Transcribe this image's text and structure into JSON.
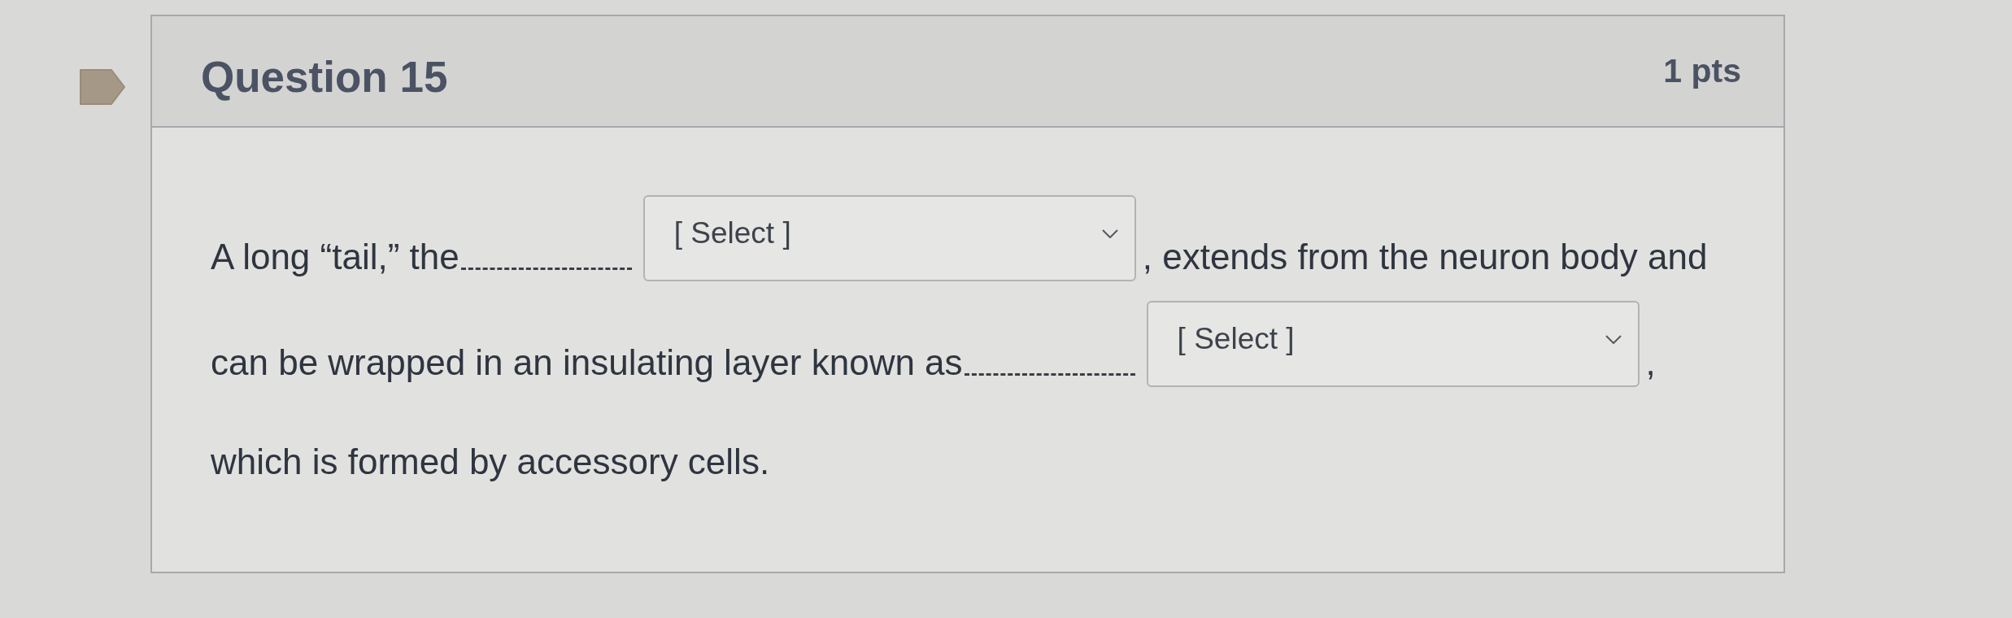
{
  "question": {
    "title": "Question 15",
    "points": "1 pts",
    "lines": [
      [
        {
          "kind": "text",
          "text": "A long “tail,” the"
        },
        {
          "kind": "blank"
        },
        {
          "kind": "select",
          "value": "[ Select ]"
        },
        {
          "kind": "text",
          "text": ", extends from the neuron body and"
        }
      ],
      [
        {
          "kind": "text",
          "text": "can be wrapped in an insulating layer known as"
        },
        {
          "kind": "blank"
        },
        {
          "kind": "select",
          "value": "[ Select ]"
        },
        {
          "kind": "text",
          "text": ","
        }
      ],
      [
        {
          "kind": "text",
          "text": "which is formed by accessory cells."
        }
      ]
    ]
  }
}
